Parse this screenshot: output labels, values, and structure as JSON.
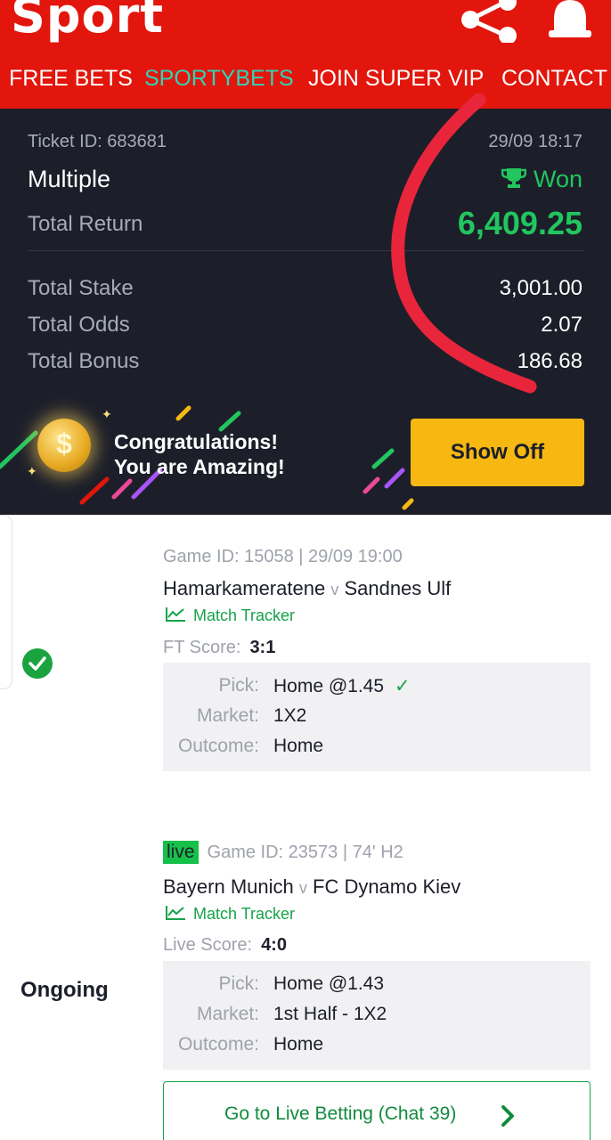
{
  "header": {
    "logo": "Sport",
    "share_icon": "share-icon",
    "bell_icon": "bell-icon",
    "nav": [
      "FREE BETS",
      "SPORTYBETS",
      "JOIN SUPER VIP",
      "CONTACT"
    ],
    "active_nav": "SPORTYBETS"
  },
  "ticket": {
    "ticket_id_label": "Ticket ID: 683681",
    "datetime": "29/09 18:17",
    "type": "Multiple",
    "status": "Won",
    "total_return_label": "Total Return",
    "total_return": "6,409.25",
    "rows": [
      {
        "label": "Total Stake",
        "value": "3,001.00"
      },
      {
        "label": "Total Odds",
        "value": "2.07"
      },
      {
        "label": "Total Bonus",
        "value": "186.68"
      }
    ]
  },
  "banner": {
    "line1": "Congratulations!",
    "line2": "You are Amazing!",
    "button": "Show Off"
  },
  "bets": [
    {
      "meta": "Game ID: 15058 | 29/09 19:00",
      "home": "Hamarkameratene",
      "vs": "v",
      "away": "Sandnes Ulf",
      "tracker": "Match Tracker",
      "score_label": "FT Score:",
      "score": "3:1",
      "pick_label": "Pick:",
      "pick": "Home @1.45",
      "market_label": "Market:",
      "market": "1X2",
      "outcome_label": "Outcome:",
      "outcome": "Home",
      "status": "won"
    },
    {
      "live_badge": "live",
      "meta": "Game ID: 23573 | 74' H2",
      "home": "Bayern Munich",
      "vs": "v",
      "away": "FC Dynamo Kiev",
      "tracker": "Match Tracker",
      "score_label": "Live Score:",
      "score": "4:0",
      "pick_label": "Pick:",
      "pick": "Home @1.43",
      "market_label": "Market:",
      "market": "1st Half - 1X2",
      "outcome_label": "Outcome:",
      "outcome": "Home",
      "status_text": "Ongoing",
      "live_button": "Go to Live Betting (Chat 39)"
    }
  ],
  "colors": {
    "header_red": "#e2160c",
    "dark_bg": "#1c1f2a",
    "won_green": "#22c55e",
    "accent_teal": "#2fd4b7",
    "show_off_yellow": "#f7b812",
    "annotation_red": "#e8253a"
  }
}
